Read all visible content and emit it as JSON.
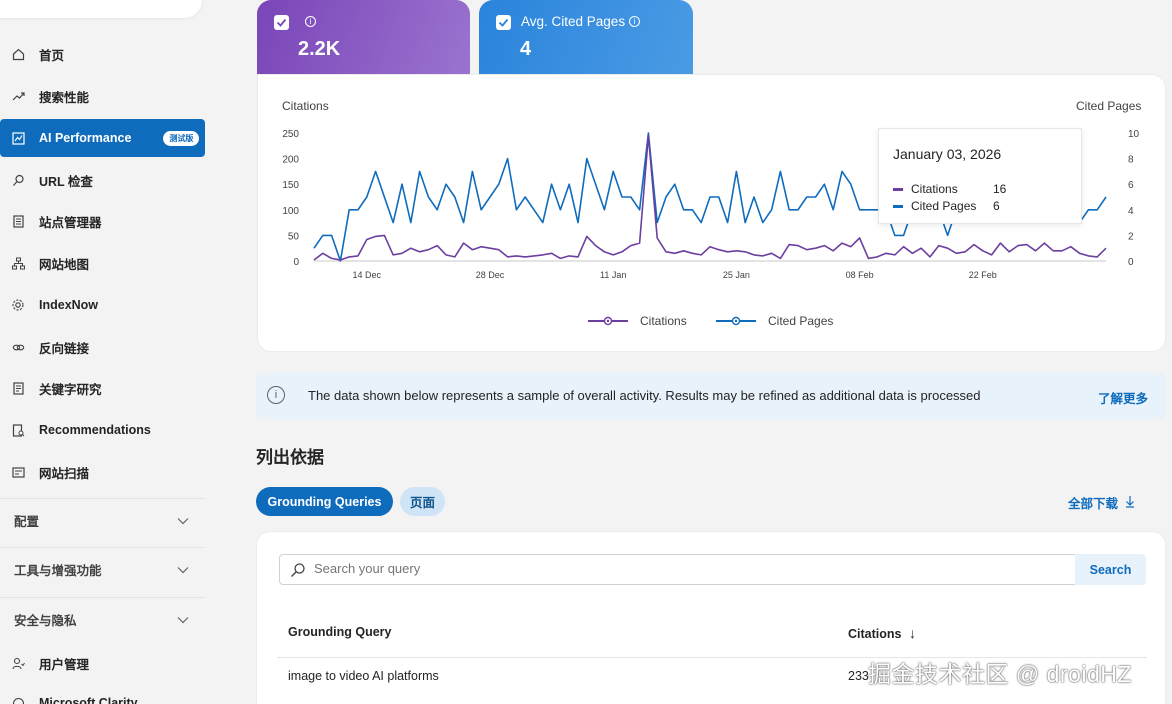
{
  "sidebar": {
    "items": [
      {
        "label": "首页",
        "icon": "home-icon"
      },
      {
        "label": "搜索性能",
        "icon": "trend-icon"
      },
      {
        "label": "AI Performance",
        "icon": "chart-icon",
        "badge": "测试版",
        "active": true
      },
      {
        "label": "URL 检查",
        "icon": "search-icon"
      },
      {
        "label": "站点管理器",
        "icon": "document-icon"
      },
      {
        "label": "网站地图",
        "icon": "sitemap-icon"
      },
      {
        "label": "IndexNow",
        "icon": "gear-icon"
      },
      {
        "label": "反向链接",
        "icon": "link-icon"
      },
      {
        "label": "关键字研究",
        "icon": "document-icon"
      },
      {
        "label": "Recommendations",
        "icon": "recommend-icon"
      },
      {
        "label": "网站扫描",
        "icon": "scan-icon"
      }
    ],
    "sections": [
      {
        "label": "配置"
      },
      {
        "label": "工具与增强功能"
      },
      {
        "label": "安全与隐私"
      }
    ],
    "bottom_items": [
      {
        "label": "用户管理",
        "icon": "user-icon"
      },
      {
        "label": "Microsoft Clarity",
        "icon": "clarity-icon"
      }
    ]
  },
  "metrics": {
    "citations": {
      "label": "",
      "value": "2.2K",
      "color": "#7a45b8"
    },
    "pages": {
      "label": "Avg. Cited Pages",
      "value": "4",
      "color": "#2a84dc"
    }
  },
  "chart_data": {
    "type": "line",
    "ylabel_left": "Citations",
    "ylabel_right": "Cited Pages",
    "y_left_ticks": [
      "250",
      "200",
      "150",
      "100",
      "50",
      "0"
    ],
    "y_right_ticks": [
      "10",
      "8",
      "6",
      "4",
      "2",
      "0"
    ],
    "ylim_left": [
      0,
      250
    ],
    "ylim_right": [
      0,
      10
    ],
    "x_tick_labels": [
      "14 Dec",
      "28 Dec",
      "11 Jan",
      "25 Jan",
      "08 Feb",
      "22 Feb"
    ],
    "grid": false,
    "series": [
      {
        "name": "Citations",
        "axis": "left",
        "color": "#6b3fa0",
        "values": [
          2,
          15,
          5,
          2,
          8,
          10,
          42,
          48,
          50,
          12,
          15,
          25,
          18,
          22,
          30,
          12,
          8,
          35,
          22,
          28,
          25,
          22,
          8,
          10,
          8,
          10,
          12,
          15,
          5,
          10,
          8,
          48,
          30,
          18,
          12,
          18,
          30,
          35,
          245,
          45,
          18,
          15,
          20,
          15,
          12,
          28,
          22,
          18,
          20,
          18,
          12,
          10,
          15,
          5,
          32,
          30,
          22,
          25,
          30,
          20,
          35,
          28,
          45,
          5,
          8,
          15,
          12,
          28,
          15,
          25,
          8,
          30,
          25,
          15,
          18,
          32,
          20,
          12,
          35,
          18,
          30,
          32,
          20,
          35,
          20,
          20,
          28,
          15,
          10,
          8,
          25
        ]
      },
      {
        "name": "Cited Pages",
        "axis": "right",
        "color": "#0f6cbd",
        "values": [
          1,
          2,
          2,
          0,
          4,
          4,
          5,
          7,
          5,
          3,
          6,
          3,
          7,
          5,
          4,
          6,
          5,
          3,
          7,
          4,
          5,
          6,
          8,
          4,
          5,
          4,
          3,
          6,
          4,
          6,
          3,
          8,
          6,
          4,
          7,
          5,
          5,
          4,
          10,
          3,
          5,
          6,
          4,
          4,
          3,
          5,
          5,
          3,
          7,
          3,
          5,
          3,
          4,
          7,
          4,
          4,
          5,
          5,
          6,
          4,
          7,
          6,
          4,
          4,
          4,
          4,
          2,
          2,
          4,
          5,
          4,
          4,
          2,
          4,
          3,
          5,
          3,
          3,
          5,
          3,
          4,
          4,
          3,
          4,
          3,
          4,
          4,
          3,
          4,
          4,
          5
        ]
      }
    ],
    "legend": [
      {
        "name": "Citations",
        "color": "#6b3fa0"
      },
      {
        "name": "Cited Pages",
        "color": "#0f6cbd"
      }
    ],
    "legend_position": "bottom-center",
    "tooltip": {
      "date": "January 03, 2026",
      "rows": [
        {
          "name": "Citations",
          "value": "16"
        },
        {
          "name": "Cited Pages",
          "value": "6"
        }
      ]
    }
  },
  "notice": {
    "text": "The data shown below represents a sample of overall activity. Results may be refined as additional data is processed",
    "link": "了解更多"
  },
  "grounding": {
    "title": "列出依据",
    "tabs": [
      {
        "label": "Grounding Queries",
        "active": true
      },
      {
        "label": "页面",
        "active": false
      }
    ],
    "download": "全部下载",
    "search_placeholder": "Search your query",
    "search_button": "Search",
    "columns": [
      "Grounding Query",
      "Citations"
    ],
    "sort_indicator": "↓",
    "rows": [
      {
        "query": "image to video AI platforms",
        "citations": "233"
      }
    ]
  },
  "watermark": "掘金技术社区 @ droidHZ"
}
